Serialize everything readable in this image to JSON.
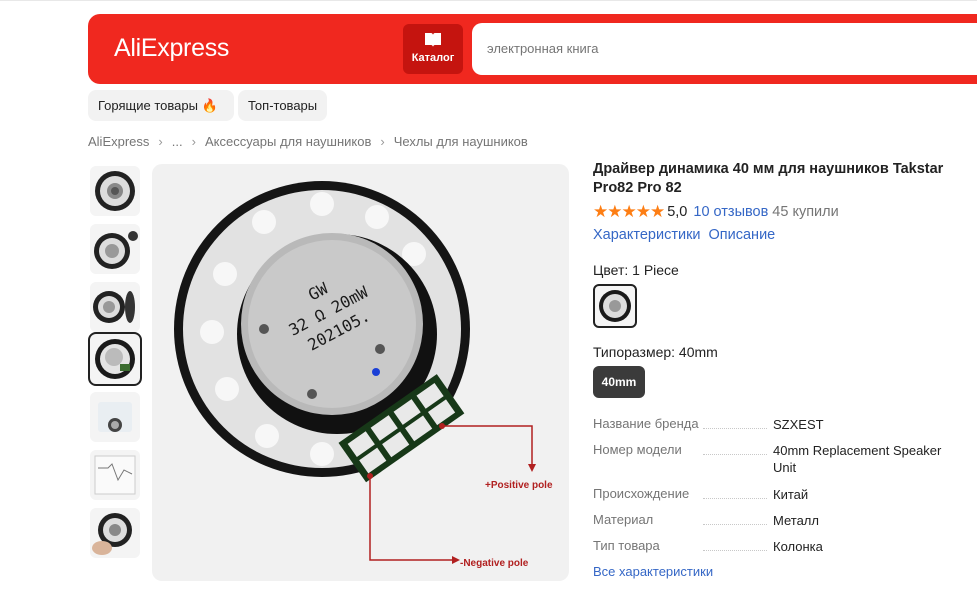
{
  "header": {
    "logo": "AliExpress",
    "catalog_label": "Каталог",
    "search_placeholder": "электронная книга",
    "brand_color": "#f0281f"
  },
  "pills": [
    {
      "label": "Горящие товары 🔥"
    },
    {
      "label": "Топ-товары"
    }
  ],
  "breadcrumb": [
    "AliExpress",
    "...",
    "Аксессуары для наушников",
    "Чехлы для наушников"
  ],
  "gallery": {
    "thumbnails_count": 7,
    "active_index": 3,
    "image_labels": {
      "line1": "GW",
      "line2": "32 Ω 20mW",
      "line3": "202105.",
      "positive": "+Positive pole",
      "negative": "-Negative pole"
    }
  },
  "product": {
    "title": "Драйвер динамика 40 мм для наушников Takstar Pro82 Pro 82",
    "stars": "★★★★★",
    "rating": "5,0",
    "reviews": "10 отзывов",
    "sold": "45 купили",
    "tab_specs": "Характеристики",
    "tab_description": "Описание",
    "color_label": "Цвет: 1 Piece",
    "size_label": "Типоразмер: 40mm",
    "size_option": "40mm"
  },
  "specs": [
    {
      "key": "Название бренда",
      "value": "SZXEST"
    },
    {
      "key": "Номер модели",
      "value": "40mm Replacement Speaker Unit"
    },
    {
      "key": "Происхождение",
      "value": "Китай"
    },
    {
      "key": "Материал",
      "value": "Металл"
    },
    {
      "key": "Тип товара",
      "value": "Колонка"
    }
  ],
  "all_specs_link": "Все характеристики"
}
